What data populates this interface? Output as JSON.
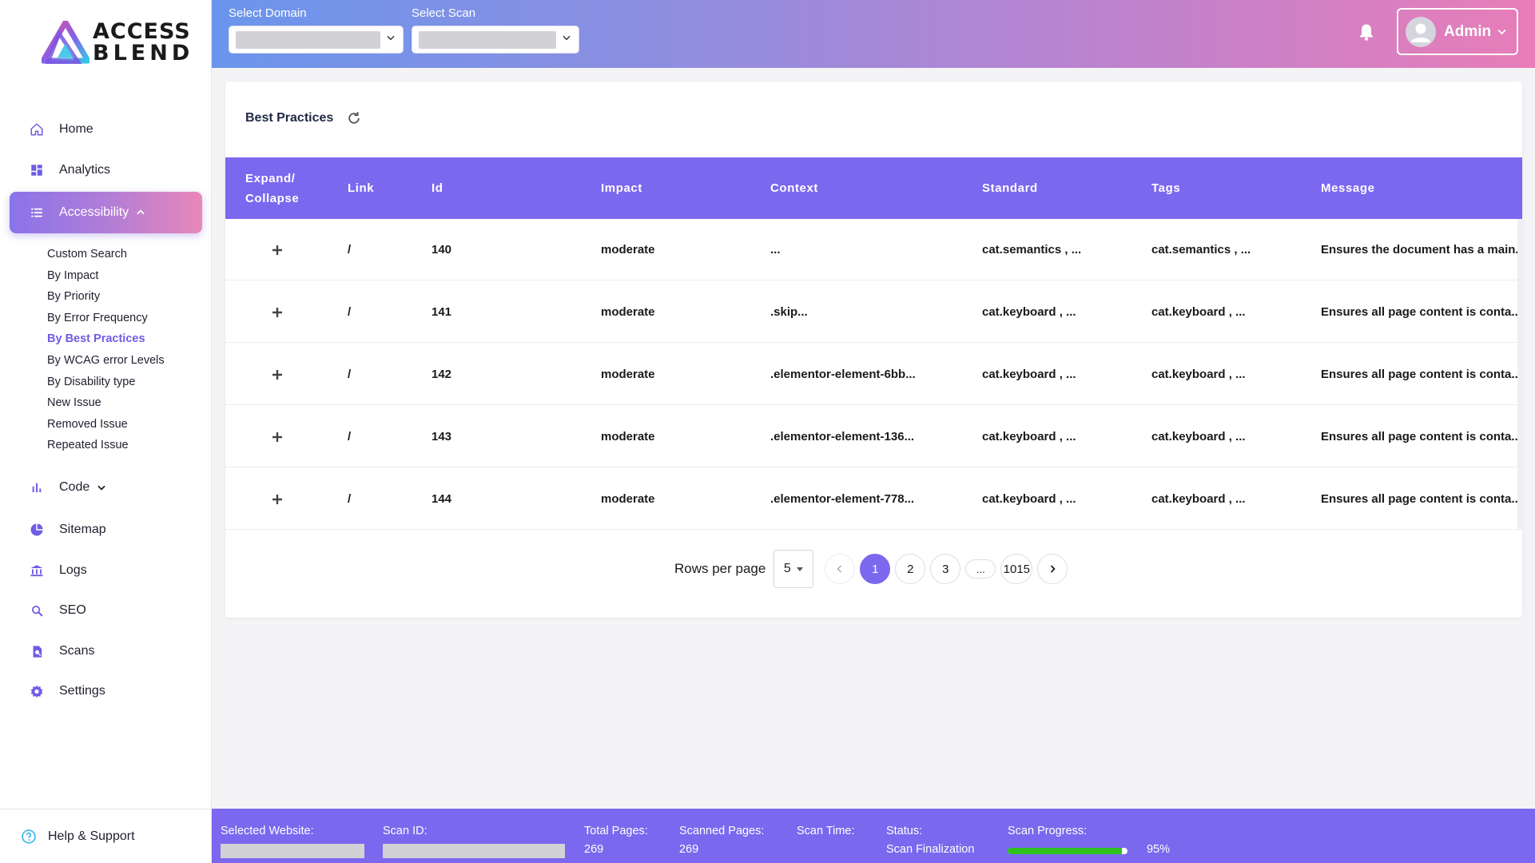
{
  "brand": {
    "line1": "ACCESS",
    "line2": "BLEND"
  },
  "colors": {
    "accent": "#7b68ee",
    "progress": "#2fc01f",
    "header_start": "#6a95ec",
    "header_end": "#e87db8"
  },
  "sidebar": {
    "items": [
      {
        "label": "Home",
        "icon": "home-icon"
      },
      {
        "label": "Analytics",
        "icon": "dashboard-icon"
      },
      {
        "label": "Accessibility",
        "icon": "list-icon",
        "expanded": true
      },
      {
        "label": "Code",
        "icon": "bar-chart-icon"
      },
      {
        "label": "Sitemap",
        "icon": "pie-chart-icon"
      },
      {
        "label": "Logs",
        "icon": "bank-icon"
      },
      {
        "label": "SEO",
        "icon": "search-icon"
      },
      {
        "label": "Scans",
        "icon": "find-in-page-icon"
      },
      {
        "label": "Settings",
        "icon": "gear-icon"
      }
    ],
    "subitems": [
      "Custom Search",
      "By Impact",
      "By Priority",
      "By Error Frequency",
      "By Best Practices",
      "By WCAG error Levels",
      "By Disability type",
      "New Issue",
      "Removed Issue",
      "Repeated Issue"
    ],
    "active_sub": "By Best Practices",
    "help": "Help & Support"
  },
  "header": {
    "domain_label": "Select Domain",
    "scan_label": "Select Scan",
    "user": "Admin"
  },
  "card": {
    "title": "Best Practices",
    "columns": [
      "Expand/\nCollapse",
      "Link",
      "Id",
      "Impact",
      "Context",
      "Standard",
      "Tags",
      "Message"
    ],
    "rows": [
      {
        "link": "/",
        "id": "140",
        "impact": "moderate",
        "context": "...",
        "standard": "cat.semantics , ...",
        "tags": "cat.semantics , ...",
        "message": "Ensures the document has a main..."
      },
      {
        "link": "/",
        "id": "141",
        "impact": "moderate",
        "context": ".skip...",
        "standard": "cat.keyboard , ...",
        "tags": "cat.keyboard , ...",
        "message": "Ensures all page content is conta..."
      },
      {
        "link": "/",
        "id": "142",
        "impact": "moderate",
        "context": ".elementor-element-6bb...",
        "standard": "cat.keyboard , ...",
        "tags": "cat.keyboard , ...",
        "message": "Ensures all page content is conta..."
      },
      {
        "link": "/",
        "id": "143",
        "impact": "moderate",
        "context": ".elementor-element-136...",
        "standard": "cat.keyboard , ...",
        "tags": "cat.keyboard , ...",
        "message": "Ensures all page content is conta..."
      },
      {
        "link": "/",
        "id": "144",
        "impact": "moderate",
        "context": ".elementor-element-778...",
        "standard": "cat.keyboard , ...",
        "tags": "cat.keyboard , ...",
        "message": "Ensures all page content is conta..."
      }
    ],
    "pagination": {
      "rows_per_page_label": "Rows per page",
      "rows_per_page": "5",
      "pages": [
        "1",
        "2",
        "3",
        "...",
        "1015"
      ],
      "current": "1"
    }
  },
  "footer": {
    "selected_website_label": "Selected Website:",
    "scan_id_label": "Scan ID:",
    "total_pages_label": "Total Pages:",
    "total_pages": "269",
    "scanned_pages_label": "Scanned Pages:",
    "scanned_pages": "269",
    "scan_time_label": "Scan Time:",
    "status_label": "Status:",
    "status": "Scan Finalization",
    "scan_progress_label": "Scan Progress:",
    "scan_progress": "95%",
    "scan_progress_value": 0.95
  }
}
